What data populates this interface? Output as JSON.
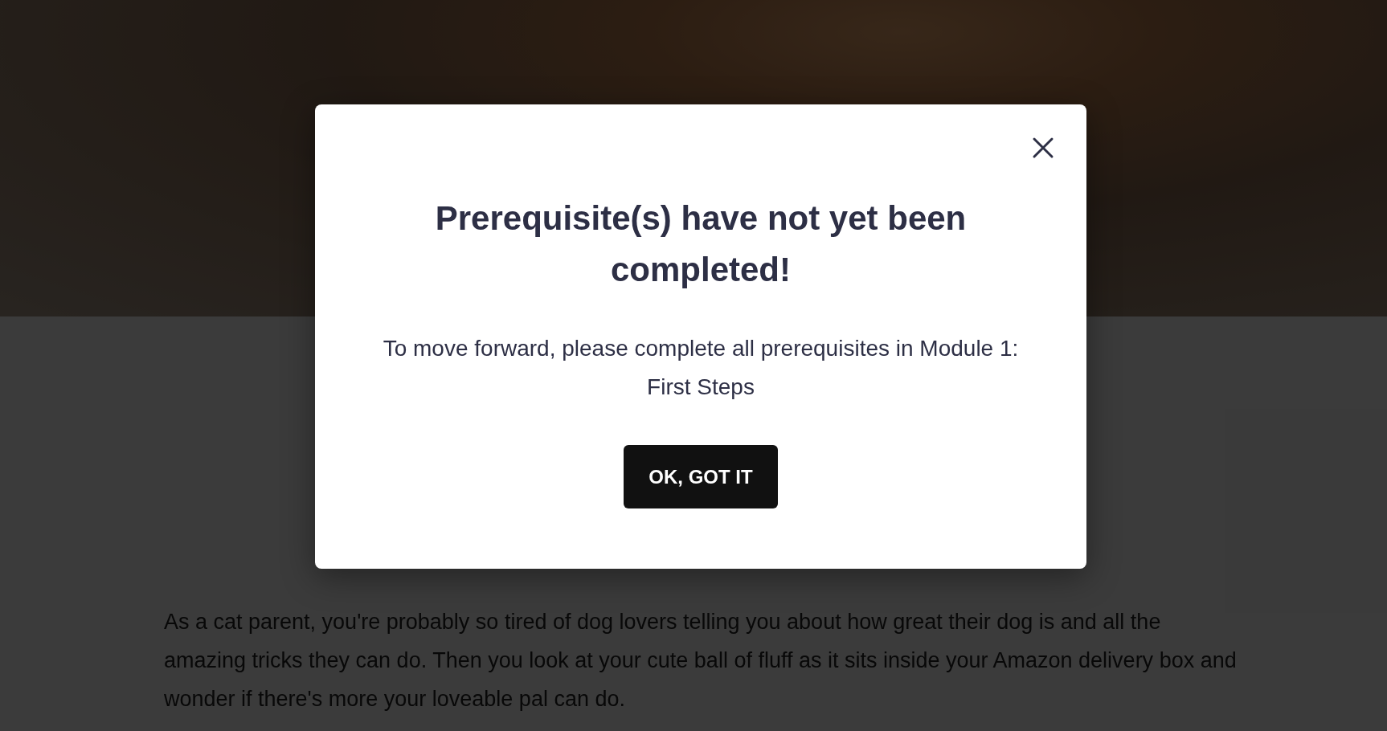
{
  "article": {
    "paragraph": "As a cat parent, you're probably so tired of dog lovers telling you about how great their dog is and all the amazing tricks they can do. Then you look at your cute ball of fluff as it sits inside your Amazon delivery box and wonder if there's more your loveable pal can do."
  },
  "modal": {
    "title": "Prerequisite(s) have not yet been completed!",
    "message": "To move forward, please complete all prerequisites in Module 1: First Steps",
    "button": "OK, GOT IT"
  }
}
